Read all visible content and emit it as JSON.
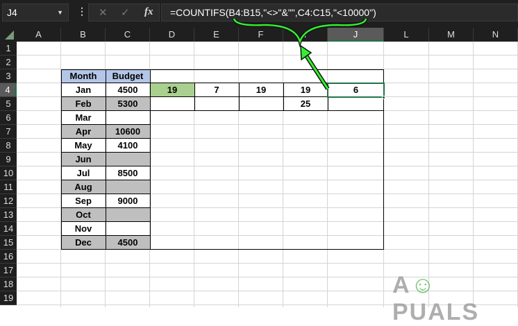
{
  "name_box": "J4",
  "formula_bar": {
    "cancel_icon": "close-icon",
    "enter_icon": "check-icon",
    "fx_label": "fx",
    "formula": "=COUNTIFS(B4:B15,\"<>\"&\"\",C4:C15,\"<10000\")"
  },
  "columns": [
    "A",
    "B",
    "C",
    "D",
    "E",
    "F",
    "I",
    "J",
    "L",
    "M",
    "N"
  ],
  "rows": [
    "1",
    "2",
    "3",
    "4",
    "5",
    "6",
    "7",
    "8",
    "9",
    "10",
    "11",
    "12",
    "13",
    "14",
    "15",
    "16",
    "17",
    "18",
    "19"
  ],
  "cells": {
    "B3": "Month",
    "C3": "Budget",
    "B4": "Jan",
    "C4": "4500",
    "D4": "19",
    "E4": "7",
    "F4": "19",
    "I4": "19",
    "J4": "6",
    "B5": "Feb",
    "C5": "5300",
    "I5": "25",
    "B6": "Mar",
    "B7": "Apr",
    "C7": "10600",
    "B8": "May",
    "C8": "4100",
    "B9": "Jun",
    "B10": "Jul",
    "C10": "8500",
    "B11": "Aug",
    "B12": "Sep",
    "C12": "9000",
    "B13": "Oct",
    "B14": "Nov",
    "B15": "Dec",
    "C15": "4500"
  },
  "watermark": "APPUALS",
  "colors": {
    "header_fill": "#b4c6e7",
    "alt_row_fill": "#bfbfbf",
    "highlight_fill": "#a9d08e",
    "annotation": "#22dd22",
    "selection": "#217346"
  }
}
